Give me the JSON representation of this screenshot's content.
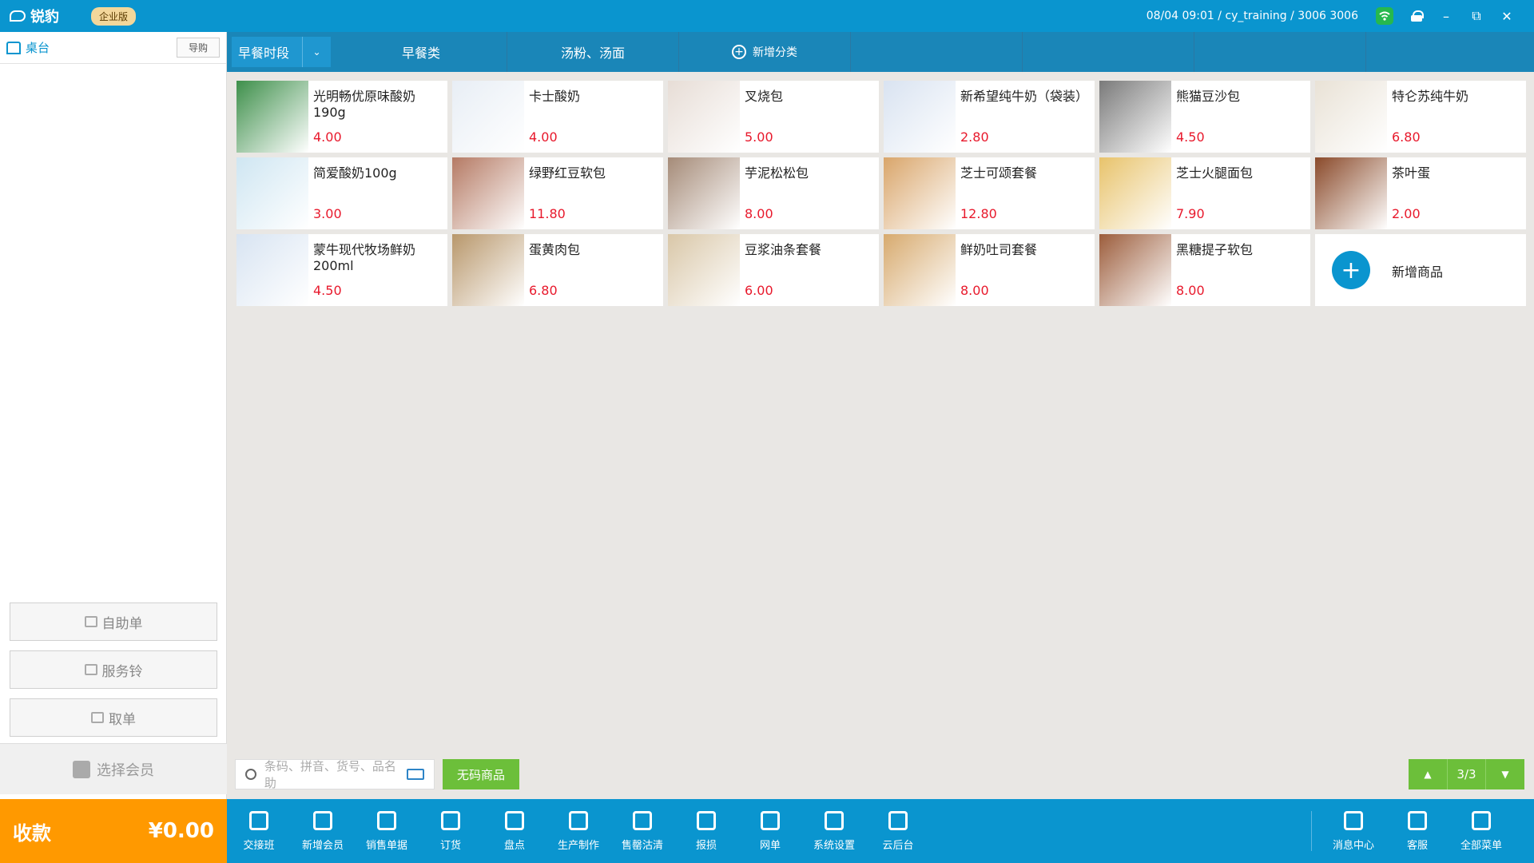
{
  "app": {
    "logo_text": "锐豹",
    "edition": "企业版",
    "status": "08/04 09:01 / cy_training / 3006 3006"
  },
  "window": {
    "minimize": "–",
    "restore": "⧉",
    "close": "✕"
  },
  "left": {
    "title": "桌台",
    "guide_button": "导购",
    "buttons": [
      "自助单",
      "服务铃",
      "取单"
    ],
    "member": "选择会员",
    "pay_label": "收款",
    "pay_amount": "¥0.00"
  },
  "categories": {
    "period": "早餐时段",
    "items": [
      "早餐类",
      "汤粉、汤面"
    ],
    "add_label": "新增分类"
  },
  "products": [
    {
      "name": "光明畅优原味酸奶190g",
      "price": "4.00",
      "color": "#3d8f4a"
    },
    {
      "name": "卡士酸奶",
      "price": "4.00",
      "color": "#e8eef5"
    },
    {
      "name": "叉烧包",
      "price": "5.00",
      "color": "#e7ddd6"
    },
    {
      "name": "新希望纯牛奶（袋装）",
      "price": "2.80",
      "color": "#d9e3f1"
    },
    {
      "name": "熊猫豆沙包",
      "price": "4.50",
      "color": "#7a7a7a"
    },
    {
      "name": "特仑苏纯牛奶",
      "price": "6.80",
      "color": "#e9e2d6"
    },
    {
      "name": "简爱酸奶100g",
      "price": "3.00",
      "color": "#cfe6f2"
    },
    {
      "name": "绿野红豆软包",
      "price": "11.80",
      "color": "#b57a64"
    },
    {
      "name": "芋泥松松包",
      "price": "8.00",
      "color": "#a58b78"
    },
    {
      "name": "芝士可颂套餐",
      "price": "12.80",
      "color": "#d9a56a"
    },
    {
      "name": "芝士火腿面包",
      "price": "7.90",
      "color": "#e8c36b"
    },
    {
      "name": "茶叶蛋",
      "price": "2.00",
      "color": "#8a4a2a"
    },
    {
      "name": "蒙牛现代牧场鲜奶200ml",
      "price": "4.50",
      "color": "#d8e4f2"
    },
    {
      "name": "蛋黄肉包",
      "price": "6.80",
      "color": "#b8976b"
    },
    {
      "name": "豆浆油条套餐",
      "price": "6.00",
      "color": "#d9c7a8"
    },
    {
      "name": "鲜奶吐司套餐",
      "price": "8.00",
      "color": "#d7aa6e"
    },
    {
      "name": "黑糖提子软包",
      "price": "8.00",
      "color": "#9c5d3c"
    }
  ],
  "add_product": "新增商品",
  "search": {
    "placeholder": "条码、拼音、货号、品名助"
  },
  "nocode_button": "无码商品",
  "pager": {
    "page": "3/3",
    "up": "▲",
    "down": "▼"
  },
  "toolbar": [
    "交接班",
    "新增会员",
    "销售单据",
    "订货",
    "盘点",
    "生产制作",
    "售罄沽清",
    "报损",
    "网单",
    "系统设置",
    "云后台"
  ],
  "toolbar_right": [
    "消息中心",
    "客服",
    "全部菜单"
  ]
}
